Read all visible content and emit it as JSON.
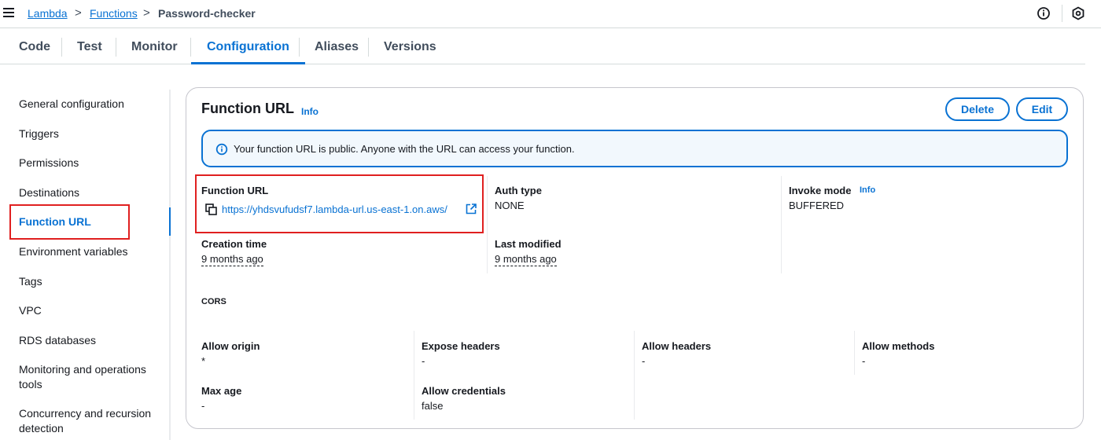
{
  "breadcrumb": {
    "items": [
      "Lambda",
      "Functions",
      "Password-checker"
    ],
    "separator": ">"
  },
  "tabs": [
    {
      "label": "Code"
    },
    {
      "label": "Test"
    },
    {
      "label": "Monitor"
    },
    {
      "label": "Configuration",
      "active": true
    },
    {
      "label": "Aliases"
    },
    {
      "label": "Versions"
    }
  ],
  "sidenav": {
    "items": [
      {
        "label": "General configuration"
      },
      {
        "label": "Triggers"
      },
      {
        "label": "Permissions"
      },
      {
        "label": "Destinations"
      },
      {
        "label": "Function URL",
        "active": true
      },
      {
        "label": "Environment variables"
      },
      {
        "label": "Tags"
      },
      {
        "label": "VPC"
      },
      {
        "label": "RDS databases"
      },
      {
        "label": "Monitoring and operations tools"
      },
      {
        "label": "Concurrency and recursion detection"
      }
    ]
  },
  "panel": {
    "title": "Function URL",
    "info": "Info",
    "delete_label": "Delete",
    "edit_label": "Edit",
    "alert": "Your function URL is public. Anyone with the URL can access your function."
  },
  "details": {
    "function_url_label": "Function URL",
    "function_url_value": "https://yhdsvufudsf7.lambda-url.us-east-1.on.aws/",
    "auth_type_label": "Auth type",
    "auth_type_value": "NONE",
    "invoke_mode_label": "Invoke mode",
    "invoke_mode_info": "Info",
    "invoke_mode_value": "BUFFERED",
    "creation_time_label": "Creation time",
    "creation_time_value": "9 months ago",
    "last_modified_label": "Last modified",
    "last_modified_value": "9 months ago"
  },
  "cors": {
    "heading": "CORS",
    "allow_origin_label": "Allow origin",
    "allow_origin_value": "*",
    "expose_headers_label": "Expose headers",
    "expose_headers_value": "-",
    "allow_headers_label": "Allow headers",
    "allow_headers_value": "-",
    "allow_methods_label": "Allow methods",
    "allow_methods_value": "-",
    "max_age_label": "Max age",
    "max_age_value": "-",
    "allow_credentials_label": "Allow credentials",
    "allow_credentials_value": "false"
  },
  "colors": {
    "accent": "#0972d3",
    "highlight_box": "#e02020",
    "alert_bg": "#f2f8fd"
  },
  "icons": [
    "menu-icon",
    "info-circle-icon",
    "settings-hex-icon",
    "info-icon",
    "copy-icon",
    "external-link-icon"
  ]
}
